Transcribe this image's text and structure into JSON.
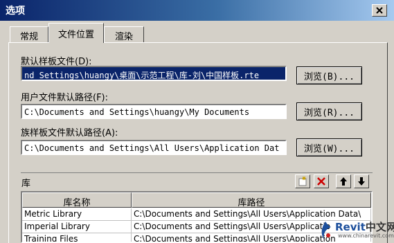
{
  "window": {
    "title": "选项"
  },
  "tabs": [
    {
      "label": "常规"
    },
    {
      "label": "文件位置",
      "active": true
    },
    {
      "label": "渲染"
    }
  ],
  "fields": {
    "template": {
      "label": "默认样板文件(D):",
      "value": "nd Settings\\huangy\\桌面\\示范工程\\库-刘\\中国样板.rte",
      "selected": true
    },
    "user_path": {
      "label": "用户文件默认路径(F):",
      "value": "C:\\Documents and Settings\\huangy\\My Documents"
    },
    "family_path": {
      "label": "族样板文件默认路径(A):",
      "value": "C:\\Documents and Settings\\All Users\\Application Dat"
    }
  },
  "buttons": {
    "browse_b": "浏览(B)...",
    "browse_r": "浏览(R)...",
    "browse_w": "浏览(W)..."
  },
  "library": {
    "title": "库",
    "toolbar_icons": [
      "new-icon",
      "delete-icon",
      "arrow-up-icon",
      "arrow-down-icon"
    ],
    "columns": [
      "库名称",
      "库路径"
    ],
    "rows": [
      {
        "name": "Metric Library",
        "path": "C:\\Documents and Settings\\All Users\\Application Data\\"
      },
      {
        "name": "Imperial Library",
        "path": "C:\\Documents and Settings\\All Users\\Applicatio"
      },
      {
        "name": "Training Files",
        "path": "C:\\Documents and Settings\\All Users\\Application"
      }
    ]
  },
  "watermark": {
    "brand": "Revit",
    "cn": "中文网",
    "url": "www.chinarevit.com"
  },
  "colors": {
    "titlebar": "#0a246a",
    "selection": "#0a246a",
    "dialog": "#d4d0c8",
    "delete_red": "#cc0000"
  }
}
